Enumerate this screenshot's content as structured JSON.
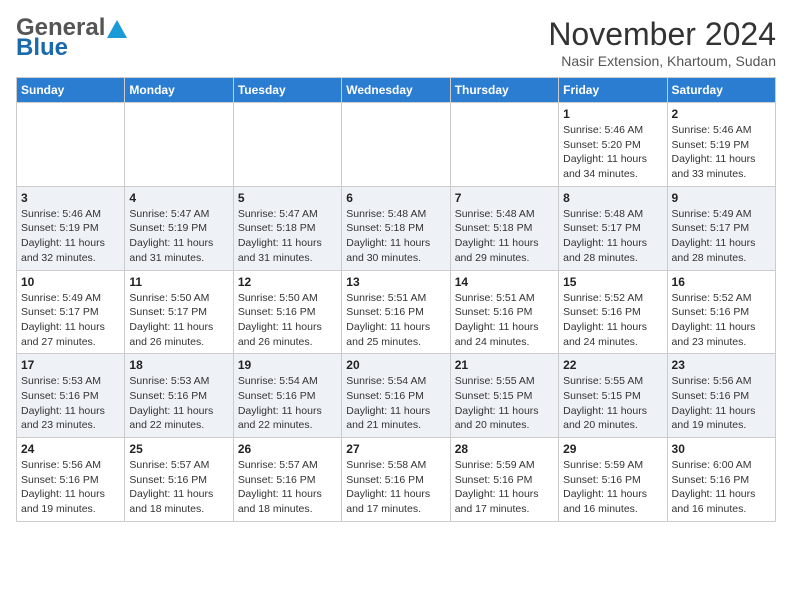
{
  "header": {
    "logo_line1": "General",
    "logo_line2": "Blue",
    "month": "November 2024",
    "location": "Nasir Extension, Khartoum, Sudan"
  },
  "weekdays": [
    "Sunday",
    "Monday",
    "Tuesday",
    "Wednesday",
    "Thursday",
    "Friday",
    "Saturday"
  ],
  "weeks": [
    [
      {
        "day": "",
        "info": ""
      },
      {
        "day": "",
        "info": ""
      },
      {
        "day": "",
        "info": ""
      },
      {
        "day": "",
        "info": ""
      },
      {
        "day": "",
        "info": ""
      },
      {
        "day": "1",
        "info": "Sunrise: 5:46 AM\nSunset: 5:20 PM\nDaylight: 11 hours and 34 minutes."
      },
      {
        "day": "2",
        "info": "Sunrise: 5:46 AM\nSunset: 5:19 PM\nDaylight: 11 hours and 33 minutes."
      }
    ],
    [
      {
        "day": "3",
        "info": "Sunrise: 5:46 AM\nSunset: 5:19 PM\nDaylight: 11 hours and 32 minutes."
      },
      {
        "day": "4",
        "info": "Sunrise: 5:47 AM\nSunset: 5:19 PM\nDaylight: 11 hours and 31 minutes."
      },
      {
        "day": "5",
        "info": "Sunrise: 5:47 AM\nSunset: 5:18 PM\nDaylight: 11 hours and 31 minutes."
      },
      {
        "day": "6",
        "info": "Sunrise: 5:48 AM\nSunset: 5:18 PM\nDaylight: 11 hours and 30 minutes."
      },
      {
        "day": "7",
        "info": "Sunrise: 5:48 AM\nSunset: 5:18 PM\nDaylight: 11 hours and 29 minutes."
      },
      {
        "day": "8",
        "info": "Sunrise: 5:48 AM\nSunset: 5:17 PM\nDaylight: 11 hours and 28 minutes."
      },
      {
        "day": "9",
        "info": "Sunrise: 5:49 AM\nSunset: 5:17 PM\nDaylight: 11 hours and 28 minutes."
      }
    ],
    [
      {
        "day": "10",
        "info": "Sunrise: 5:49 AM\nSunset: 5:17 PM\nDaylight: 11 hours and 27 minutes."
      },
      {
        "day": "11",
        "info": "Sunrise: 5:50 AM\nSunset: 5:17 PM\nDaylight: 11 hours and 26 minutes."
      },
      {
        "day": "12",
        "info": "Sunrise: 5:50 AM\nSunset: 5:16 PM\nDaylight: 11 hours and 26 minutes."
      },
      {
        "day": "13",
        "info": "Sunrise: 5:51 AM\nSunset: 5:16 PM\nDaylight: 11 hours and 25 minutes."
      },
      {
        "day": "14",
        "info": "Sunrise: 5:51 AM\nSunset: 5:16 PM\nDaylight: 11 hours and 24 minutes."
      },
      {
        "day": "15",
        "info": "Sunrise: 5:52 AM\nSunset: 5:16 PM\nDaylight: 11 hours and 24 minutes."
      },
      {
        "day": "16",
        "info": "Sunrise: 5:52 AM\nSunset: 5:16 PM\nDaylight: 11 hours and 23 minutes."
      }
    ],
    [
      {
        "day": "17",
        "info": "Sunrise: 5:53 AM\nSunset: 5:16 PM\nDaylight: 11 hours and 23 minutes."
      },
      {
        "day": "18",
        "info": "Sunrise: 5:53 AM\nSunset: 5:16 PM\nDaylight: 11 hours and 22 minutes."
      },
      {
        "day": "19",
        "info": "Sunrise: 5:54 AM\nSunset: 5:16 PM\nDaylight: 11 hours and 22 minutes."
      },
      {
        "day": "20",
        "info": "Sunrise: 5:54 AM\nSunset: 5:16 PM\nDaylight: 11 hours and 21 minutes."
      },
      {
        "day": "21",
        "info": "Sunrise: 5:55 AM\nSunset: 5:15 PM\nDaylight: 11 hours and 20 minutes."
      },
      {
        "day": "22",
        "info": "Sunrise: 5:55 AM\nSunset: 5:15 PM\nDaylight: 11 hours and 20 minutes."
      },
      {
        "day": "23",
        "info": "Sunrise: 5:56 AM\nSunset: 5:16 PM\nDaylight: 11 hours and 19 minutes."
      }
    ],
    [
      {
        "day": "24",
        "info": "Sunrise: 5:56 AM\nSunset: 5:16 PM\nDaylight: 11 hours and 19 minutes."
      },
      {
        "day": "25",
        "info": "Sunrise: 5:57 AM\nSunset: 5:16 PM\nDaylight: 11 hours and 18 minutes."
      },
      {
        "day": "26",
        "info": "Sunrise: 5:57 AM\nSunset: 5:16 PM\nDaylight: 11 hours and 18 minutes."
      },
      {
        "day": "27",
        "info": "Sunrise: 5:58 AM\nSunset: 5:16 PM\nDaylight: 11 hours and 17 minutes."
      },
      {
        "day": "28",
        "info": "Sunrise: 5:59 AM\nSunset: 5:16 PM\nDaylight: 11 hours and 17 minutes."
      },
      {
        "day": "29",
        "info": "Sunrise: 5:59 AM\nSunset: 5:16 PM\nDaylight: 11 hours and 16 minutes."
      },
      {
        "day": "30",
        "info": "Sunrise: 6:00 AM\nSunset: 5:16 PM\nDaylight: 11 hours and 16 minutes."
      }
    ]
  ]
}
